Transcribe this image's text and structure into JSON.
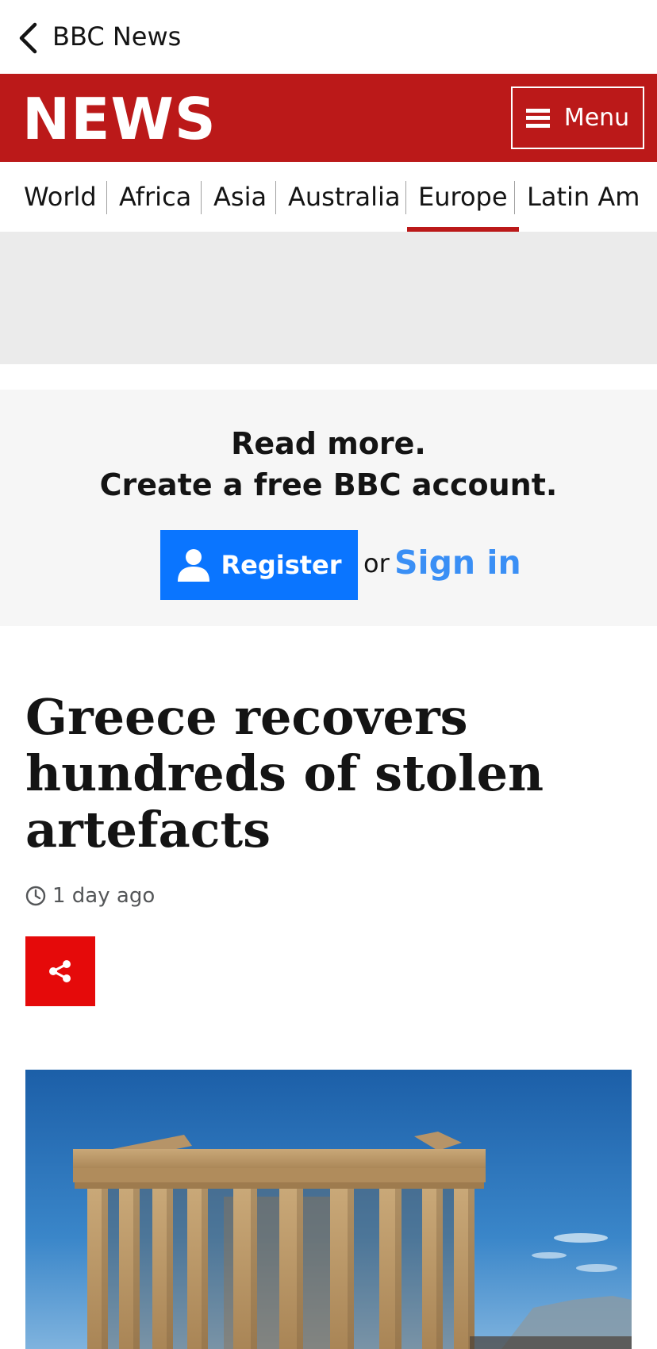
{
  "appbar": {
    "title": "BBC News"
  },
  "masthead": {
    "brand": "NEWS",
    "menu_label": "Menu"
  },
  "nav": {
    "items": [
      {
        "label": "World"
      },
      {
        "label": "Africa"
      },
      {
        "label": "Asia"
      },
      {
        "label": "Australia"
      },
      {
        "label": "Europe",
        "active": true
      },
      {
        "label": "Latin Am"
      }
    ]
  },
  "promo": {
    "line1": "Read more.",
    "line2": "Create a free BBC account.",
    "register_label": "Register",
    "or_text": "or",
    "signin_label": "Sign in"
  },
  "article": {
    "headline": "Greece recovers hundreds of stolen artefacts",
    "timestamp": "1 day ago"
  },
  "colors": {
    "brand_red": "#bb1919",
    "share_red": "#e50a0a",
    "register_blue": "#0a75ff",
    "signin_blue": "#3a8ff5"
  }
}
